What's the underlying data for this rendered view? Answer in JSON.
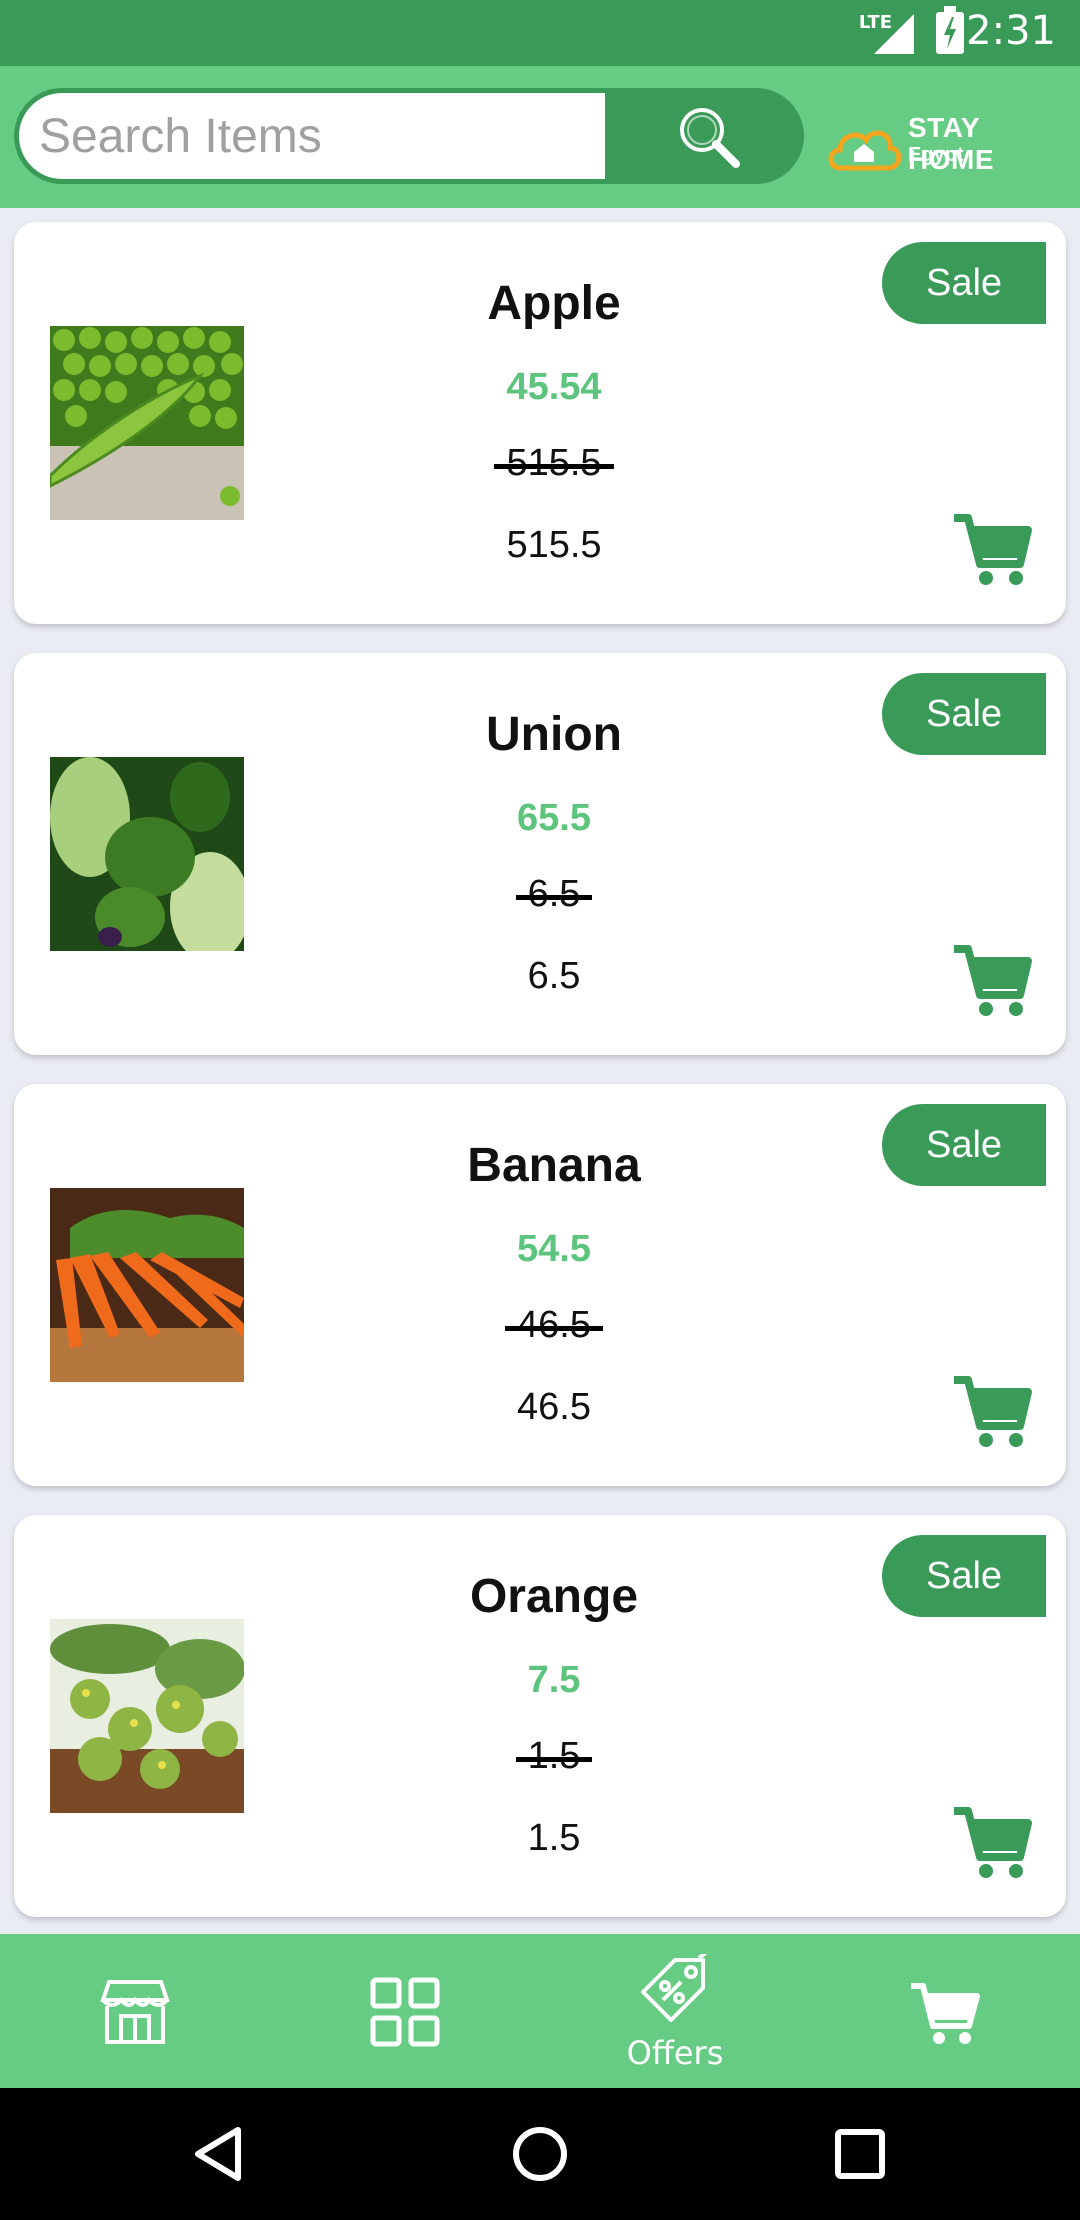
{
  "status_bar": {
    "network": "LTE",
    "time": "2:31"
  },
  "search": {
    "placeholder": "Search Items",
    "value": ""
  },
  "brand": {
    "line1": "STAY HOME",
    "line2": "Egypt"
  },
  "products": [
    {
      "name": "Apple",
      "price": "45.54",
      "old_price": "515.5",
      "current_price": "515.5",
      "badge": "Sale",
      "image": "green-peas"
    },
    {
      "name": "Union",
      "price": "65.5",
      "old_price": "6.5",
      "current_price": "6.5",
      "badge": "Sale",
      "image": "leafy-greens"
    },
    {
      "name": "Banana",
      "price": "54.5",
      "old_price": "46.5",
      "current_price": "46.5",
      "badge": "Sale",
      "image": "carrots"
    },
    {
      "name": "Orange",
      "price": "7.5",
      "old_price": "1.5",
      "current_price": "1.5",
      "badge": "Sale",
      "image": "broccoli-rabe"
    }
  ],
  "bottom_nav": [
    {
      "icon": "store-icon",
      "label": ""
    },
    {
      "icon": "grid-icon",
      "label": ""
    },
    {
      "icon": "offers-tag-icon",
      "label": "Offers",
      "active": true
    },
    {
      "icon": "cart-icon",
      "label": ""
    }
  ],
  "system_nav": [
    "back-icon",
    "home-icon",
    "recents-icon"
  ],
  "colors": {
    "primary_dark": "#3a9b59",
    "primary": "#66cc83",
    "price": "#5cc47c"
  }
}
